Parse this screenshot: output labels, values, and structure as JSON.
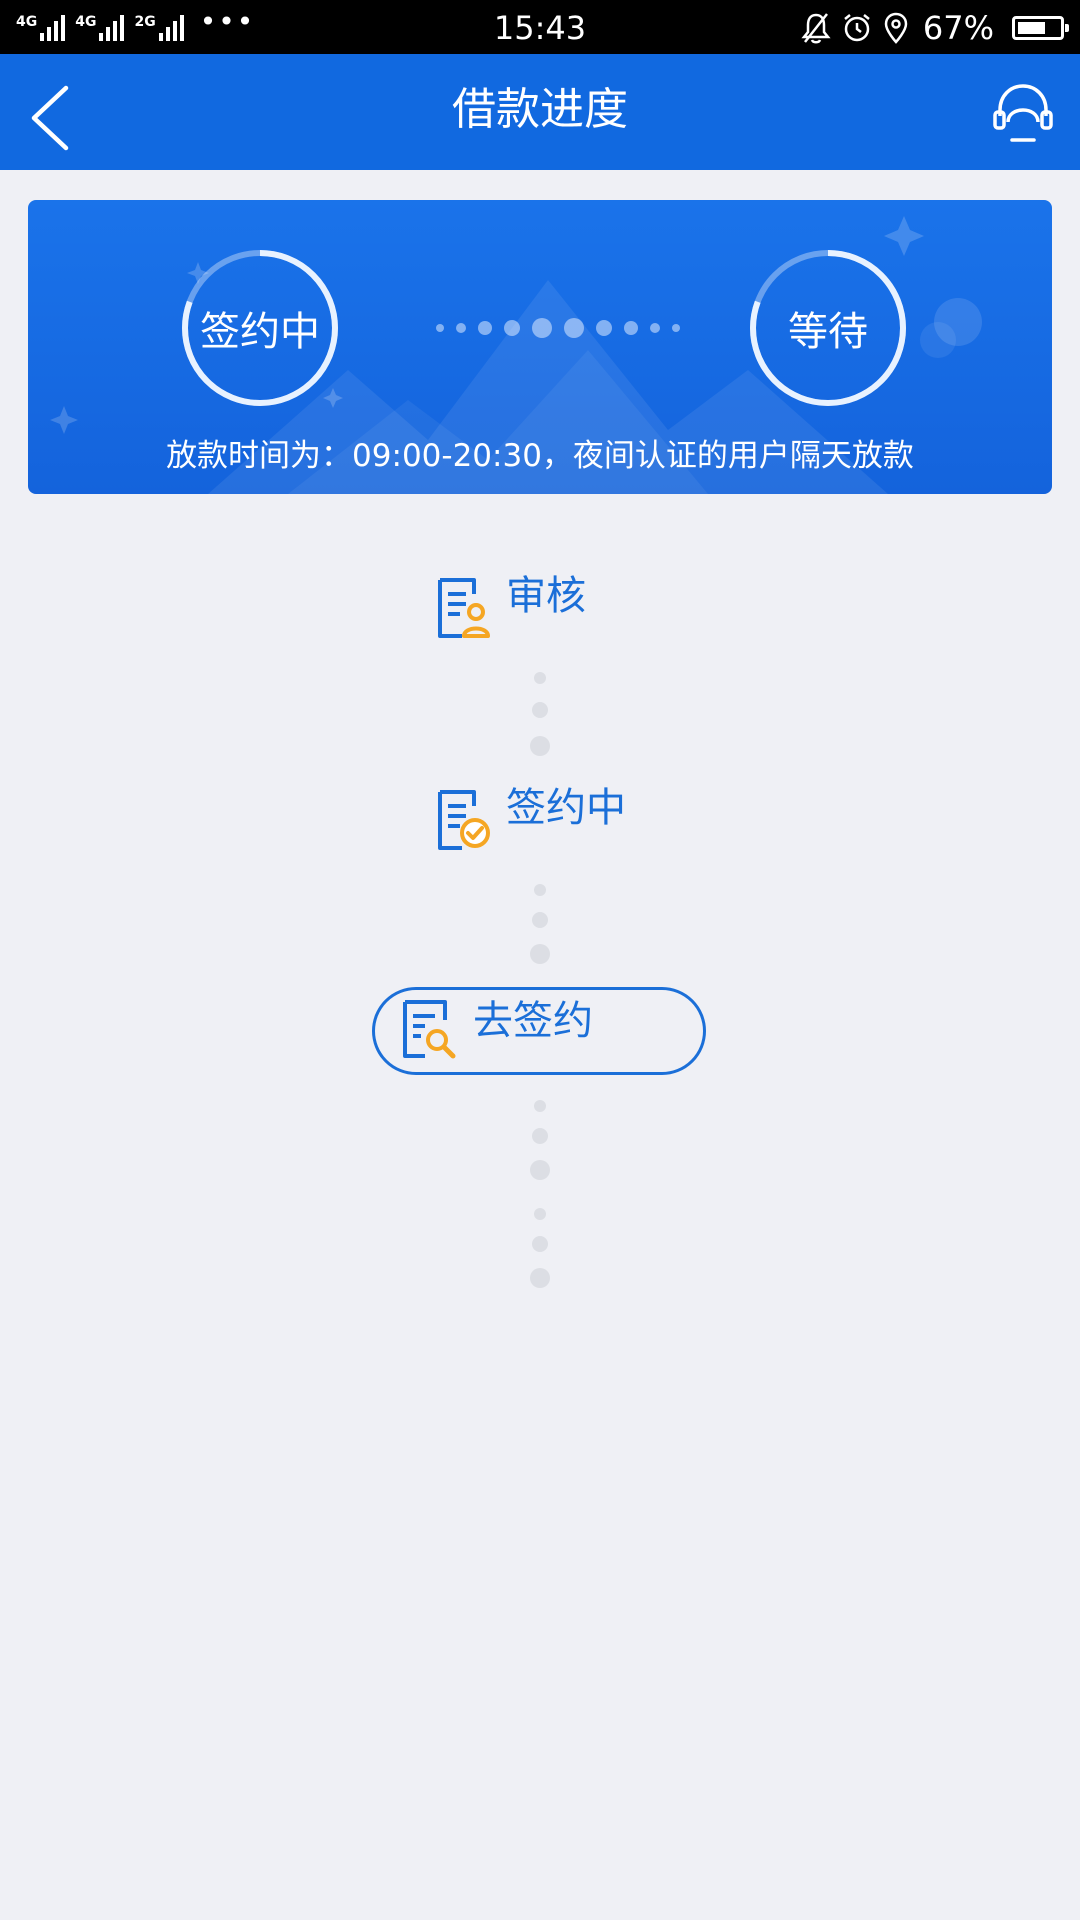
{
  "status_bar": {
    "network1": "4G",
    "network2": "4G",
    "network3": "2G",
    "more": "•••",
    "time": "15:43",
    "battery_percent": "67%",
    "battery_level": 0.67
  },
  "nav": {
    "title": "借款进度",
    "back_icon": "chevron-left-icon",
    "service_icon": "headset-icon"
  },
  "banner": {
    "left_status": "签约中",
    "right_status": "等待",
    "note": "放款时间为：09:00-20:30，夜间认证的用户隔天放款"
  },
  "steps": [
    {
      "label": "审核",
      "icon": "document-user-icon"
    },
    {
      "label": "签约中",
      "icon": "document-check-icon"
    }
  ],
  "action": {
    "label": "去签约",
    "icon": "document-search-icon"
  },
  "colors": {
    "primary": "#1169e0",
    "accent": "#f5a623",
    "background": "#eff0f5",
    "text_blue": "#1b6fd8"
  }
}
